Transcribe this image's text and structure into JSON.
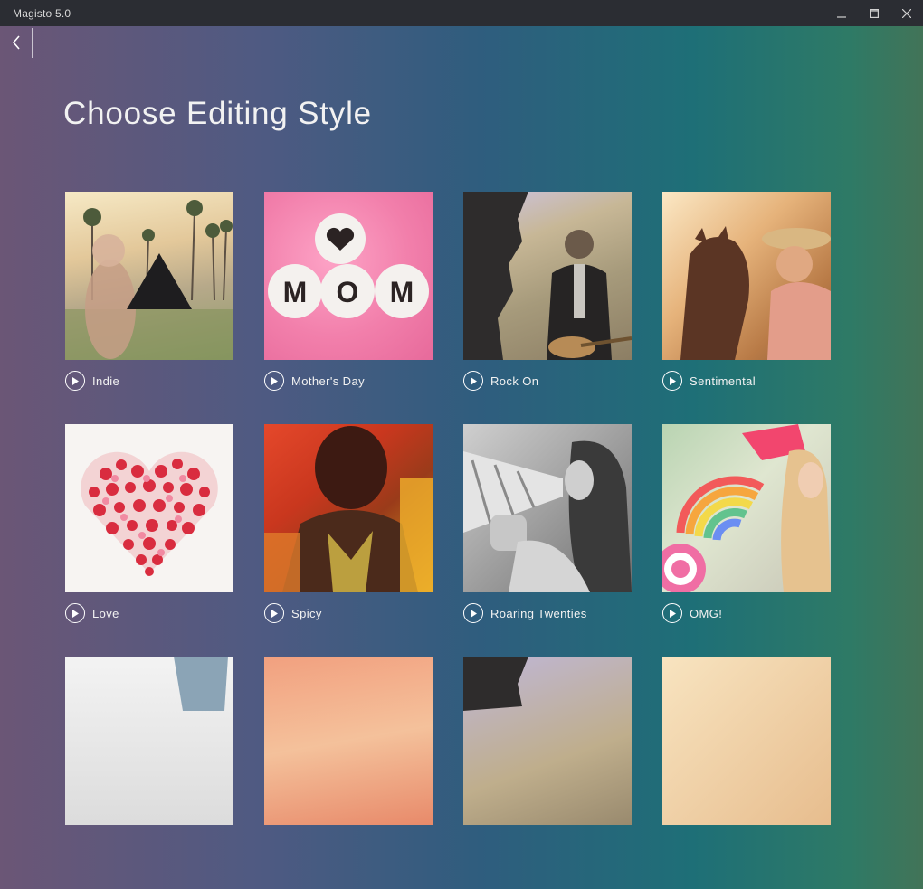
{
  "window": {
    "title": "Magisto 5.0"
  },
  "nav": {
    "back_icon": "chevron-left-icon"
  },
  "page": {
    "title": "Choose Editing Style"
  },
  "styles": [
    {
      "label": "Indie"
    },
    {
      "label": "Mother's Day"
    },
    {
      "label": "Rock On"
    },
    {
      "label": "Sentimental"
    },
    {
      "label": "Love"
    },
    {
      "label": "Spicy"
    },
    {
      "label": "Roaring Twenties"
    },
    {
      "label": "OMG!"
    }
  ],
  "thumbnail_text": {
    "mom": "MOM"
  },
  "colors": {
    "titlebar": "#2b2d33",
    "gradient_left": "#6b5676",
    "gradient_mid": "#2f5d7e",
    "gradient_right": "#427458"
  }
}
